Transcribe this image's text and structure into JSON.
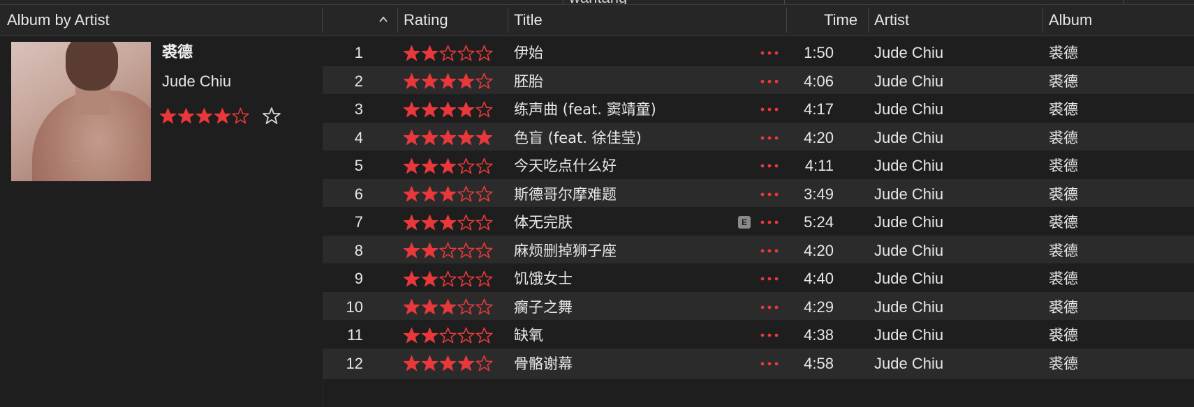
{
  "top_strip": {
    "clipped_text": "wantang"
  },
  "header": {
    "album_by_artist": "Album by Artist",
    "rating": "Rating",
    "title": "Title",
    "time": "Time",
    "artist": "Artist",
    "album": "Album",
    "sort_icon": "chevron-up-icon"
  },
  "album": {
    "name": "裘德",
    "artist": "Jude Chiu",
    "rating": 4,
    "max_rating": 5,
    "love_icon": "star-outline-icon"
  },
  "colors": {
    "accent": "#e8383b",
    "row_alt": "#2b2b2b",
    "background": "#1e1e1e",
    "explicit_badge": "#8a8a8a"
  },
  "tracks": [
    {
      "number": "1",
      "rating": 2,
      "title": "伊始",
      "explicit": false,
      "time": "1:50",
      "artist": "Jude Chiu",
      "album": "裘德"
    },
    {
      "number": "2",
      "rating": 4,
      "title": "胚胎",
      "explicit": false,
      "time": "4:06",
      "artist": "Jude Chiu",
      "album": "裘德"
    },
    {
      "number": "3",
      "rating": 4,
      "title": "练声曲 (feat. 窦靖童)",
      "explicit": false,
      "time": "4:17",
      "artist": "Jude Chiu",
      "album": "裘德"
    },
    {
      "number": "4",
      "rating": 5,
      "title": "色盲 (feat. 徐佳莹)",
      "explicit": false,
      "time": "4:20",
      "artist": "Jude Chiu",
      "album": "裘德"
    },
    {
      "number": "5",
      "rating": 3,
      "title": "今天吃点什么好",
      "explicit": false,
      "time": "4:11",
      "artist": "Jude Chiu",
      "album": "裘德"
    },
    {
      "number": "6",
      "rating": 3,
      "title": "斯德哥尔摩难题",
      "explicit": false,
      "time": "3:49",
      "artist": "Jude Chiu",
      "album": "裘德"
    },
    {
      "number": "7",
      "rating": 3,
      "title": "体无完肤",
      "explicit": true,
      "time": "5:24",
      "artist": "Jude Chiu",
      "album": "裘德"
    },
    {
      "number": "8",
      "rating": 2,
      "title": "麻烦删掉狮子座",
      "explicit": false,
      "time": "4:20",
      "artist": "Jude Chiu",
      "album": "裘德"
    },
    {
      "number": "9",
      "rating": 2,
      "title": "饥饿女士",
      "explicit": false,
      "time": "4:40",
      "artist": "Jude Chiu",
      "album": "裘德"
    },
    {
      "number": "10",
      "rating": 3,
      "title": "瘸子之舞",
      "explicit": false,
      "time": "4:29",
      "artist": "Jude Chiu",
      "album": "裘德"
    },
    {
      "number": "11",
      "rating": 2,
      "title": "缺氧",
      "explicit": false,
      "time": "4:38",
      "artist": "Jude Chiu",
      "album": "裘德"
    },
    {
      "number": "12",
      "rating": 4,
      "title": "骨骼谢幕",
      "explicit": false,
      "time": "4:58",
      "artist": "Jude Chiu",
      "album": "裘德"
    }
  ],
  "explicit_badge_label": "E",
  "more_icon": "ellipsis-icon"
}
